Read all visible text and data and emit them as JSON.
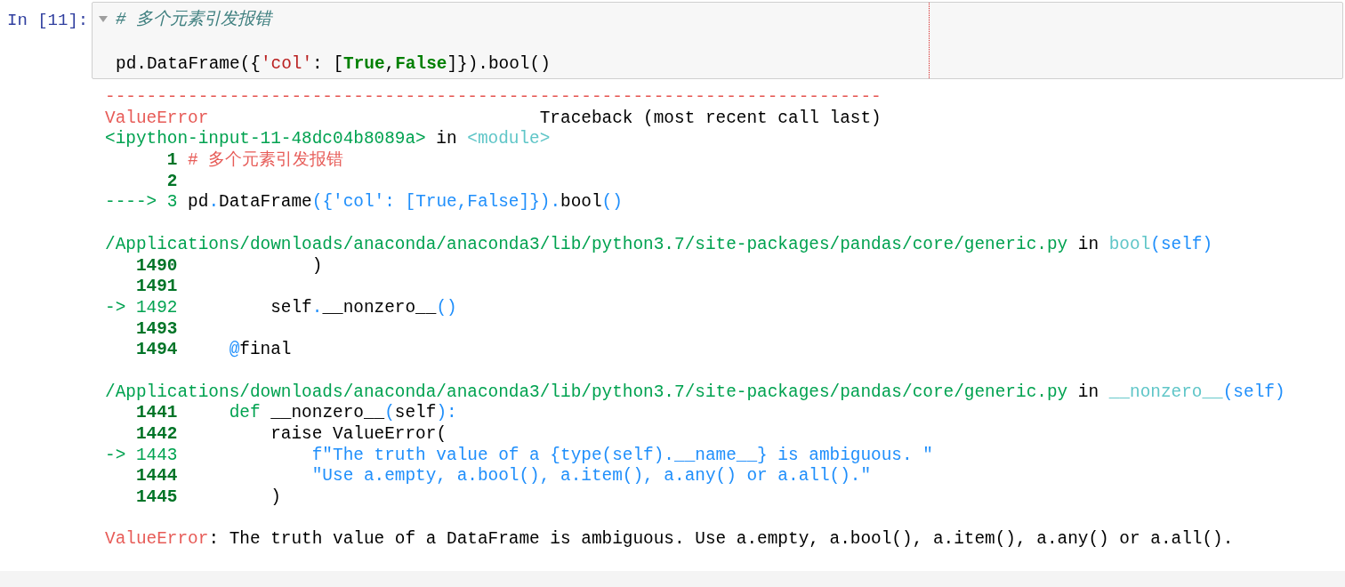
{
  "input_cell": {
    "prompt": "In [11]:",
    "code_blocks": [
      [
        [
          {
            "kind": "comment",
            "text": "# 多个元素引发报错"
          }
        ]
      ],
      [
        [
          {
            "kind": "plain",
            "text": "pd.DataFrame({"
          },
          {
            "kind": "string",
            "text": "'col'"
          },
          {
            "kind": "plain",
            "text": ": ["
          },
          {
            "kind": "keyword",
            "text": "True"
          },
          {
            "kind": "plain",
            "text": ","
          },
          {
            "kind": "keyword",
            "text": "False"
          },
          {
            "kind": "plain",
            "text": "]}).bool()"
          }
        ]
      ]
    ]
  },
  "output_blocks": [
    [
      [
        {
          "kind": "error",
          "text": "---------------------------------------------------------------------------"
        }
      ],
      [
        {
          "kind": "error",
          "text": "ValueError"
        },
        {
          "kind": "plain",
          "text": "                                Traceback (most recent call last)"
        }
      ],
      [
        {
          "kind": "path",
          "text": "<ipython-input-11-48dc04b8089a>"
        },
        {
          "kind": "plain",
          "text": " in "
        },
        {
          "kind": "func",
          "text": "<module>"
        }
      ],
      [
        {
          "kind": "lineno",
          "text": "      1 "
        },
        {
          "kind": "error",
          "text": "# 多个元素引发报错"
        }
      ],
      [
        {
          "kind": "lineno",
          "text": "      2"
        }
      ],
      [
        {
          "kind": "arrow",
          "text": "----> 3"
        },
        {
          "kind": "plain",
          "text": " pd"
        },
        {
          "kind": "call",
          "text": "."
        },
        {
          "kind": "plain",
          "text": "DataFrame"
        },
        {
          "kind": "call",
          "text": "({'col': [True,False]})."
        },
        {
          "kind": "plain",
          "text": "bool"
        },
        {
          "kind": "call",
          "text": "()"
        }
      ]
    ],
    [
      [
        {
          "kind": "path",
          "text": "/Applications/downloads/anaconda/anaconda3/lib/python3.7/site-packages/pandas/core/generic.py"
        },
        {
          "kind": "plain",
          "text": " in "
        },
        {
          "kind": "func",
          "text": "bool"
        },
        {
          "kind": "call",
          "text": "(self)"
        }
      ],
      [
        {
          "kind": "lineno",
          "text": "   1490"
        },
        {
          "kind": "plain",
          "text": "             )"
        }
      ],
      [
        {
          "kind": "lineno",
          "text": "   1491"
        }
      ],
      [
        {
          "kind": "arrow",
          "text": "-> 1492"
        },
        {
          "kind": "plain",
          "text": "         self"
        },
        {
          "kind": "call",
          "text": "."
        },
        {
          "kind": "plain",
          "text": "__nonzero__"
        },
        {
          "kind": "call",
          "text": "()"
        }
      ],
      [
        {
          "kind": "lineno",
          "text": "   1493"
        }
      ],
      [
        {
          "kind": "lineno",
          "text": "   1494     "
        },
        {
          "kind": "call",
          "text": "@"
        },
        {
          "kind": "plain",
          "text": "final"
        }
      ]
    ],
    [
      [
        {
          "kind": "path",
          "text": "/Applications/downloads/anaconda/anaconda3/lib/python3.7/site-packages/pandas/core/generic.py"
        },
        {
          "kind": "plain",
          "text": " in "
        },
        {
          "kind": "func",
          "text": "__nonzero__"
        },
        {
          "kind": "call",
          "text": "(self)"
        }
      ],
      [
        {
          "kind": "lineno",
          "text": "   1441     "
        },
        {
          "kind": "path",
          "text": "def"
        },
        {
          "kind": "plain",
          "text": " __nonzero__"
        },
        {
          "kind": "call",
          "text": "("
        },
        {
          "kind": "plain",
          "text": "self"
        },
        {
          "kind": "call",
          "text": "):"
        }
      ],
      [
        {
          "kind": "lineno",
          "text": "   1442"
        },
        {
          "kind": "plain",
          "text": "         raise ValueError("
        }
      ],
      [
        {
          "kind": "arrow",
          "text": "-> 1443             "
        },
        {
          "kind": "call",
          "text": "f\"The truth value of a {type(self).__name__} is ambiguous. \""
        }
      ],
      [
        {
          "kind": "lineno",
          "text": "   1444             "
        },
        {
          "kind": "call",
          "text": "\"Use a.empty, a.bool(), a.item(), a.any() or a.all().\""
        }
      ],
      [
        {
          "kind": "lineno",
          "text": "   1445"
        },
        {
          "kind": "plain",
          "text": "         )"
        }
      ]
    ],
    [
      [
        {
          "kind": "error",
          "text": "ValueError"
        },
        {
          "kind": "plain",
          "text": ": The truth value of a DataFrame is ambiguous. Use a.empty, a.bool(), a.item(), a.any() or a.all()."
        }
      ]
    ]
  ]
}
